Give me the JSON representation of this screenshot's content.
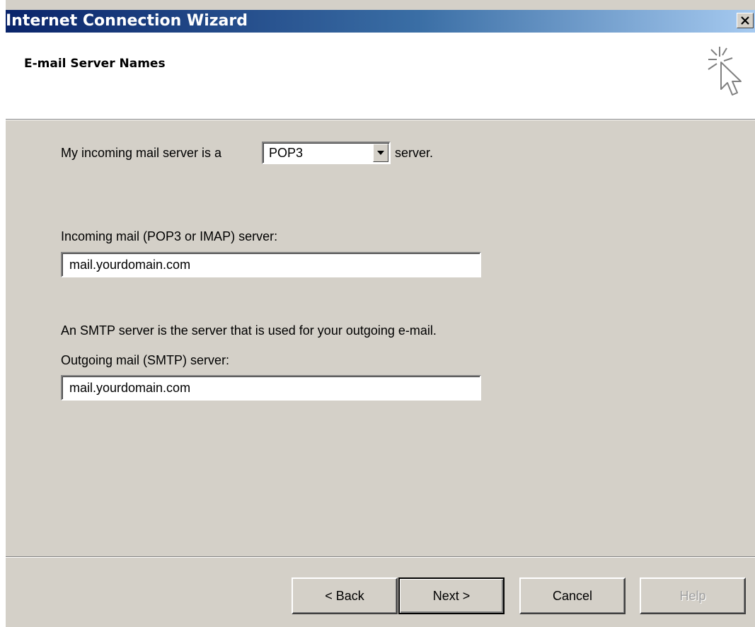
{
  "window": {
    "title": "Internet Connection Wizard",
    "close_icon": "close-icon"
  },
  "header": {
    "title": "E-mail Server Names",
    "icon": "wizard-cursor-sparkle-icon"
  },
  "form": {
    "server_type_prefix": "My incoming mail server is a",
    "server_type_value": "POP3",
    "server_type_suffix": "server.",
    "incoming_label": "Incoming mail (POP3 or IMAP) server:",
    "incoming_value": "mail.yourdomain.com",
    "smtp_info": "An SMTP server is the server that is used for your outgoing e-mail.",
    "outgoing_label": "Outgoing mail (SMTP) server:",
    "outgoing_value": "mail.yourdomain.com"
  },
  "buttons": {
    "back": "< Back",
    "next": "Next >",
    "cancel": "Cancel",
    "help": "Help"
  },
  "colors": {
    "dialog_face": "#d4d0c8",
    "title_gradient_start": "#0a246a",
    "title_gradient_end": "#a6caf0",
    "disabled_text": "#a0a0a0"
  }
}
